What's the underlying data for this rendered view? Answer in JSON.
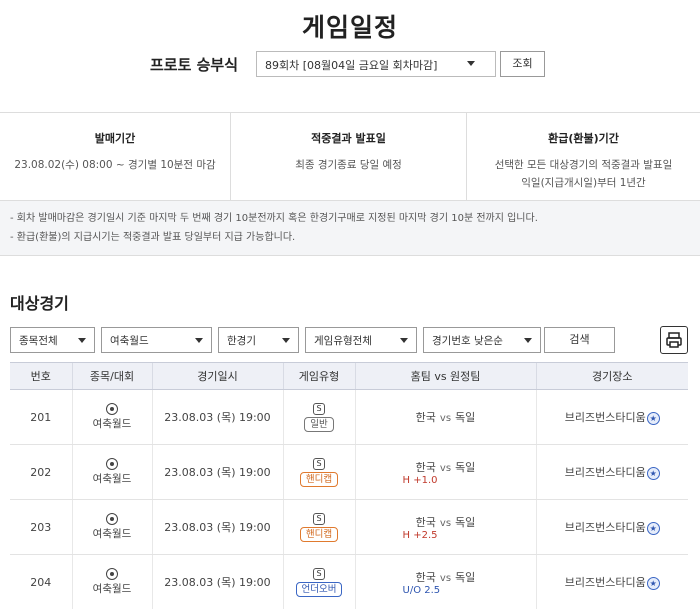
{
  "page": {
    "title": "게임일정"
  },
  "selector": {
    "label": "프로토 승부식",
    "round_value": "89회차 [08월04일 금요일 회차마감]",
    "view_button": "조회"
  },
  "info": {
    "sale_period": {
      "title": "발매기간",
      "text": "23.08.02(수) 08:00 ~ 경기별 10분전 마감"
    },
    "result": {
      "title": "적중결과 발표일",
      "text": "최종 경기종료 당일 예정"
    },
    "refund": {
      "title": "환급(환불)기간",
      "text_line1": "선택한 모든 대상경기의 적중결과 발표일",
      "text_line2": "익일(지급개시일)부터 1년간"
    }
  },
  "notice": {
    "line1": "- 회차 발매마감은 경기일시 기준 마지막 두 번째 경기 10분전까지 혹은 한경기구매로 지정된 마지막 경기 10분 전까지 입니다.",
    "line2": "- 환급(환불)의 지급시기는 적중결과 발표 당일부터 지급 가능합니다."
  },
  "section": {
    "title": "대상경기"
  },
  "filters": {
    "sport": "종목전체",
    "competition": "여축월드",
    "single_game": "한경기",
    "game_type": "게임유형전체",
    "sort": "경기번호 낮은순",
    "search_button": "검색"
  },
  "table": {
    "headers": [
      "번호",
      "종목/대회",
      "경기일시",
      "게임유형",
      "홈팀 vs 원정팀",
      "경기장소"
    ],
    "vs_label": "vs",
    "rows": [
      {
        "no": "201",
        "competition": "여축월드",
        "datetime": "23.08.03 (목) 19:00",
        "type_mark": "S",
        "type": "일반",
        "type_color": "gray",
        "home": "한국",
        "away": "독일",
        "handicap": "",
        "venue": "브리즈번스타디움",
        "venue_mark": "★"
      },
      {
        "no": "202",
        "competition": "여축월드",
        "datetime": "23.08.03 (목) 19:00",
        "type_mark": "S",
        "type": "핸디캡",
        "type_color": "orange",
        "home": "한국",
        "away": "독일",
        "handicap": "H +1.0",
        "venue": "브리즈번스타디움",
        "venue_mark": "★"
      },
      {
        "no": "203",
        "competition": "여축월드",
        "datetime": "23.08.03 (목) 19:00",
        "type_mark": "S",
        "type": "핸디캡",
        "type_color": "orange",
        "home": "한국",
        "away": "독일",
        "handicap": "H +2.5",
        "venue": "브리즈번스타디움",
        "venue_mark": "★"
      },
      {
        "no": "204",
        "competition": "여축월드",
        "datetime": "23.08.03 (목) 19:00",
        "type_mark": "S",
        "type": "언더오버",
        "type_color": "blue",
        "home": "한국",
        "away": "독일",
        "handicap": "U/O 2.5",
        "venue": "브리즈번스타디움",
        "venue_mark": "★"
      }
    ]
  },
  "colors": {
    "accent_blue": "#2f56b0",
    "handicap_red": "#c0392b",
    "handicap_orange": "#d2691e",
    "header_bg": "#eef0f6"
  }
}
